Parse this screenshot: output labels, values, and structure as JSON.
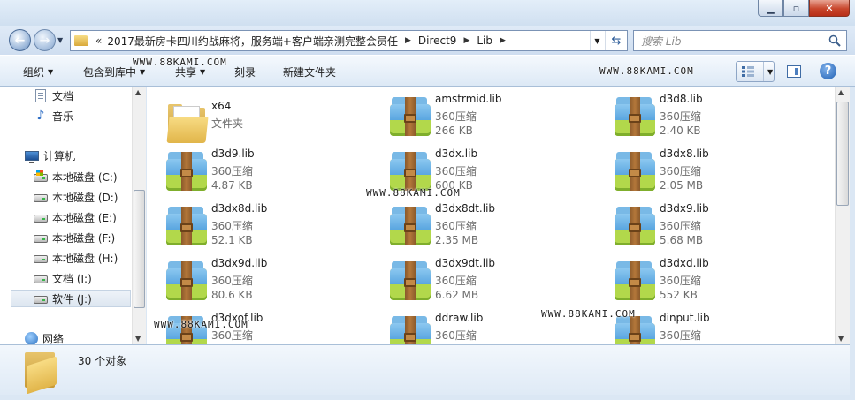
{
  "address": {
    "chevron": "«",
    "crumbs": [
      "2017最新房卡四川约战麻将，服务端+客户端亲测完整会员任",
      "Direct9",
      "Lib"
    ]
  },
  "search": {
    "placeholder": "搜索 Lib"
  },
  "toolbar": {
    "organize": "组织",
    "include_in_library": "包含到库中",
    "share": "共享",
    "burn": "刻录",
    "new_folder": "新建文件夹"
  },
  "nav": {
    "documents": "文档",
    "music": "音乐",
    "computer": "计算机",
    "drive_c": "本地磁盘 (C:)",
    "drive_d": "本地磁盘 (D:)",
    "drive_e": "本地磁盘 (E:)",
    "drive_f": "本地磁盘 (F:)",
    "drive_h": "本地磁盘 (H:)",
    "drive_i": "文档 (I:)",
    "drive_j": "软件 (J:)",
    "network": "网络"
  },
  "files": [
    {
      "name": "x64",
      "type": "文件夹",
      "size": ""
    },
    {
      "name": "amstrmid.lib",
      "type": "360压缩",
      "size": "266 KB"
    },
    {
      "name": "d3d8.lib",
      "type": "360压缩",
      "size": "2.40 KB"
    },
    {
      "name": "d3d9.lib",
      "type": "360压缩",
      "size": "4.87 KB"
    },
    {
      "name": "d3dx.lib",
      "type": "360压缩",
      "size": "600 KB"
    },
    {
      "name": "d3dx8.lib",
      "type": "360压缩",
      "size": "2.05 MB"
    },
    {
      "name": "d3dx8d.lib",
      "type": "360压缩",
      "size": "52.1 KB"
    },
    {
      "name": "d3dx8dt.lib",
      "type": "360压缩",
      "size": "2.35 MB"
    },
    {
      "name": "d3dx9.lib",
      "type": "360压缩",
      "size": "5.68 MB"
    },
    {
      "name": "d3dx9d.lib",
      "type": "360压缩",
      "size": "80.6 KB"
    },
    {
      "name": "d3dx9dt.lib",
      "type": "360压缩",
      "size": "6.62 MB"
    },
    {
      "name": "d3dxd.lib",
      "type": "360压缩",
      "size": "552 KB"
    },
    {
      "name": "d3dxof.lib",
      "type": "360压缩",
      "size": ""
    },
    {
      "name": "ddraw.lib",
      "type": "360压缩",
      "size": ""
    },
    {
      "name": "dinput.lib",
      "type": "360压缩",
      "size": ""
    }
  ],
  "status": {
    "count": "30 个对象"
  },
  "watermark": "WWW.88KAMI.COM",
  "icons": {
    "back": "back-arrow-icon",
    "forward": "forward-arrow-icon",
    "refresh": "refresh-icon",
    "search": "search-icon",
    "help": "help-icon",
    "archive": "archive-icon",
    "folder": "folder-icon"
  }
}
